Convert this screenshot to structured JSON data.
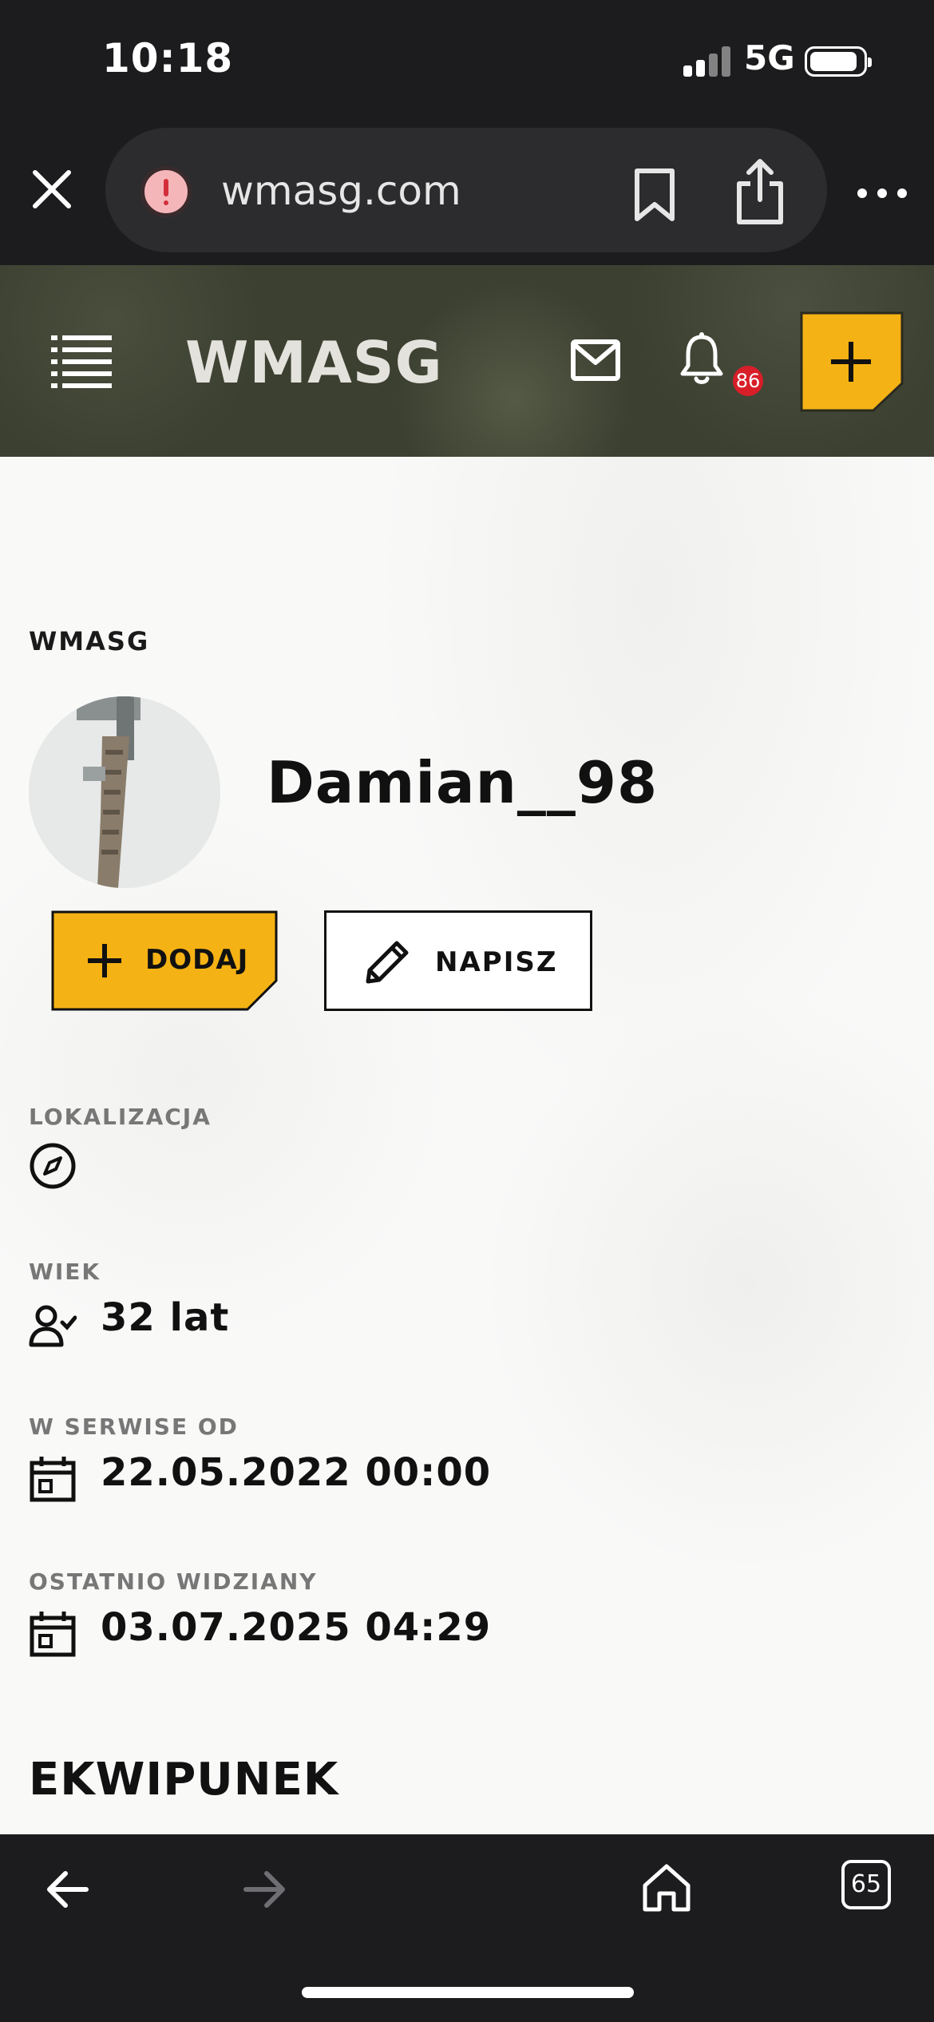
{
  "status_bar": {
    "time": "10:18",
    "network": "5G",
    "battery_level": 0.9
  },
  "browser": {
    "url": "wmasg.com",
    "tabs_count": "65",
    "icons": [
      "close-icon",
      "warning-icon",
      "bookmark-icon",
      "share-icon",
      "more-icon",
      "back-arrow-icon",
      "forward-arrow-icon",
      "home-icon"
    ]
  },
  "header": {
    "logo_text": "WMASG",
    "notification_count": "86",
    "icons": [
      "menu-icon",
      "mail-icon",
      "bell-icon",
      "plus-icon"
    ],
    "accent_color": "#f5b214"
  },
  "profile": {
    "breadcrumb": "WMASG",
    "username": "Damian__98",
    "add_button_label": "DODAJ",
    "message_button_label": "NAPISZ"
  },
  "fields": {
    "location_label": "LOKALIZACJA",
    "age_label": "WIEK",
    "age_value": "32 lat",
    "member_since_label": "W SERWISE OD",
    "member_since_value": "22.05.2022 00:00",
    "last_seen_label": "OSTATNIO WIDZIANY",
    "last_seen_value": "03.07.2025 04:29"
  },
  "sections": {
    "equipment_title": "EKWIPUNEK"
  }
}
